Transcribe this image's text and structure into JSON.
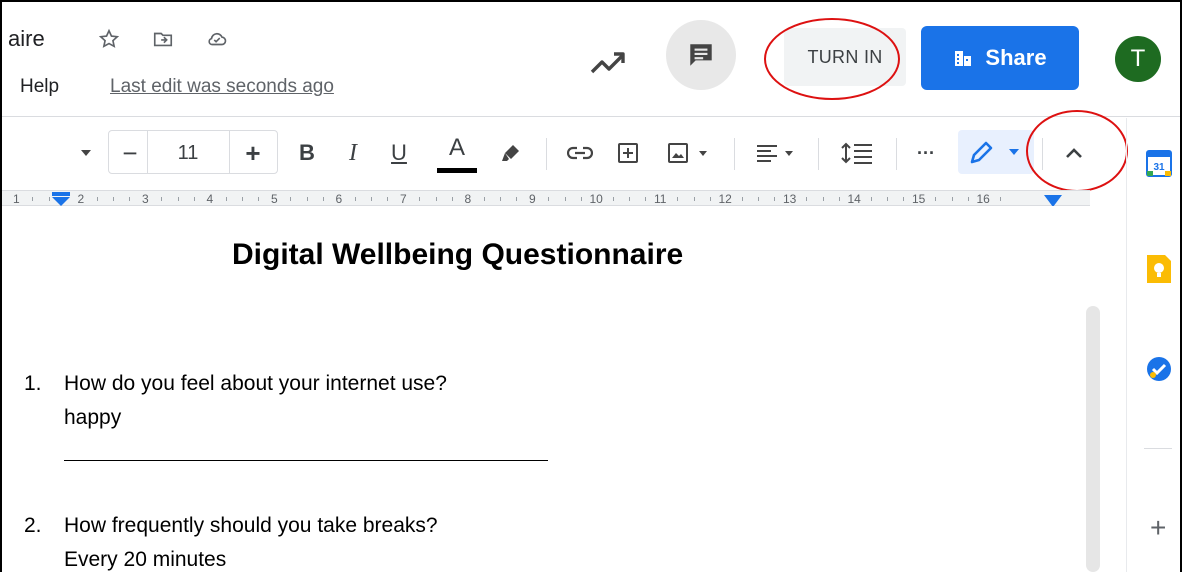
{
  "header": {
    "title": "aire",
    "menu_help": "Help",
    "last_edit": "Last edit was seconds ago",
    "turn_in_label": "TURN IN",
    "share_label": "Share",
    "avatar_letter": "T"
  },
  "toolbar": {
    "font_size": "11",
    "decrease_label": "−",
    "increase_label": "+",
    "bold_label": "B",
    "italic_label": "I",
    "underline_label": "U",
    "text_color_label": "A",
    "more_label": "···"
  },
  "ruler": {
    "numbers": [
      "1",
      "2",
      "3",
      "4",
      "5",
      "6",
      "7",
      "8",
      "9",
      "10",
      "11",
      "12",
      "13",
      "14",
      "15",
      "16"
    ]
  },
  "document": {
    "heading": "Digital Wellbeing Questionnaire",
    "questions": [
      {
        "number": "1.",
        "question": "How do you feel about your internet use?",
        "answer": "happy"
      },
      {
        "number": "2.",
        "question": "How frequently should you take breaks?",
        "answer": "Every 20 minutes"
      }
    ]
  },
  "side_panel": {
    "calendar_day": "31",
    "add_label": "+"
  },
  "colors": {
    "share_button": "#1a73e8",
    "avatar": "#1e6b21",
    "annotation": "#dd1111",
    "keep": "#fbbc04",
    "tasks": "#1a73e8"
  }
}
